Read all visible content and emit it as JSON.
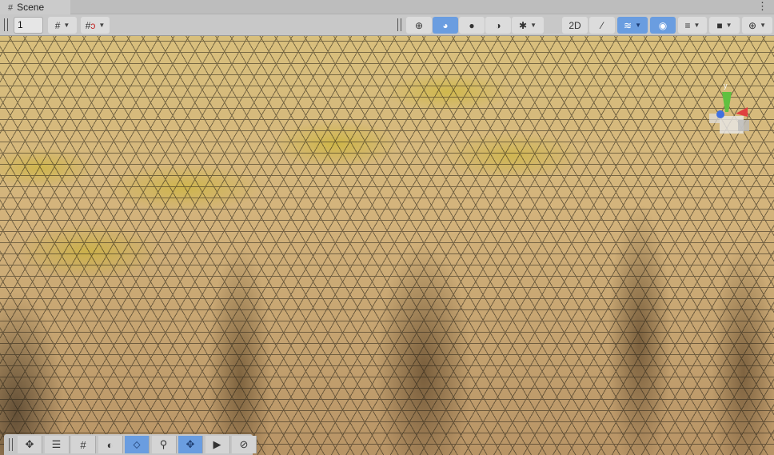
{
  "tab": {
    "title": "Scene",
    "icon": "grid-icon"
  },
  "toolbar": {
    "grid_size": "1",
    "left_buttons": [
      {
        "name": "grid-snap",
        "icon": "grid-snap-icon",
        "dropdown": true
      },
      {
        "name": "increment-snap",
        "icon": "magnet-grid-icon",
        "dropdown": true
      }
    ],
    "right_buttons": [
      {
        "name": "wireframe",
        "glyph": "⊕",
        "active": false
      },
      {
        "name": "shaded-wireframe",
        "glyph": "◕",
        "active": true
      },
      {
        "name": "shaded",
        "glyph": "●",
        "active": false
      },
      {
        "name": "unlit",
        "glyph": "◑",
        "active": false
      },
      {
        "name": "debug",
        "glyph": "✱",
        "active": false,
        "dropdown": true
      },
      {
        "name": "2d-toggle",
        "glyph": "2D",
        "active": false
      },
      {
        "name": "audio-toggle",
        "glyph": "⁄",
        "active": false
      },
      {
        "name": "effects",
        "glyph": "≋",
        "active": true,
        "dropdown": true
      },
      {
        "name": "visibility",
        "glyph": "◉",
        "active": true
      },
      {
        "name": "layers",
        "glyph": "≡",
        "active": false,
        "dropdown": true
      },
      {
        "name": "camera",
        "glyph": "■",
        "active": false,
        "dropdown": true
      },
      {
        "name": "gizmos",
        "glyph": "⊕",
        "active": false,
        "dropdown": true
      }
    ]
  },
  "gizmo": {
    "axis_label": "y",
    "colors": {
      "x": "#e04040",
      "y": "#60c040",
      "z": "#4070e0"
    }
  },
  "overlay_toolbar": [
    {
      "name": "move",
      "glyph": "✥",
      "active": false
    },
    {
      "name": "brush-settings",
      "glyph": "☰",
      "active": false
    },
    {
      "name": "wireframe-grid",
      "glyph": "#",
      "active": false
    },
    {
      "name": "shading",
      "glyph": "◐",
      "active": false
    },
    {
      "name": "mesh-select",
      "glyph": "⬦",
      "active": true
    },
    {
      "name": "search",
      "glyph": "⚲",
      "active": false
    },
    {
      "name": "vertex-move",
      "glyph": "✥",
      "active": true
    },
    {
      "name": "camera-view",
      "glyph": "▶",
      "active": false
    },
    {
      "name": "compass",
      "glyph": "⊘",
      "active": false
    }
  ],
  "colors": {
    "active": "#6a9de0",
    "toolbar": "#c8c8c8"
  }
}
